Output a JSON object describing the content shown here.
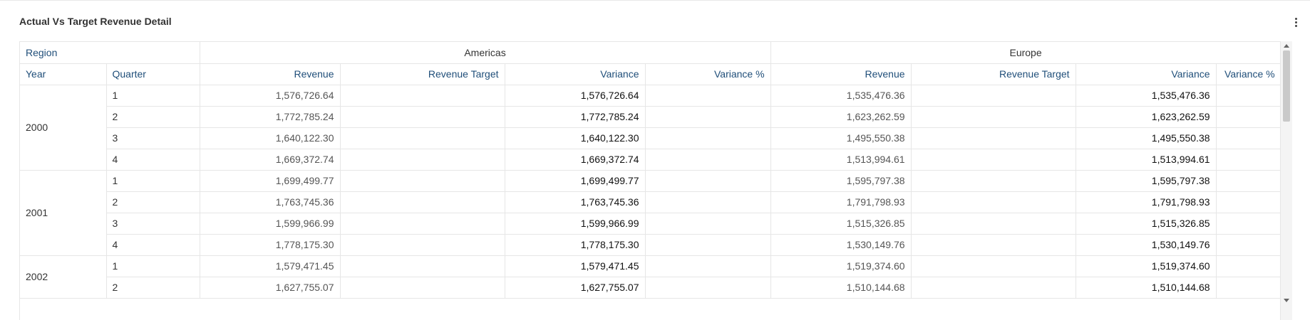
{
  "panel": {
    "title": "Actual Vs Target Revenue Detail",
    "menu_icon": "more-vertical-icon"
  },
  "table": {
    "region_label": "Region",
    "groups": [
      "Americas",
      "Europe"
    ],
    "year_label": "Year",
    "quarter_label": "Quarter",
    "columns": [
      "Revenue",
      "Revenue Target",
      "Variance",
      "Variance %"
    ],
    "years": [
      {
        "year": "2000",
        "rows": [
          {
            "quarter": "1",
            "am_rev": "1,576,726.64",
            "am_target": "",
            "am_var": "1,576,726.64",
            "am_varpct": "",
            "eu_rev": "1,535,476.36",
            "eu_target": "",
            "eu_var": "1,535,476.36",
            "eu_varpct": ""
          },
          {
            "quarter": "2",
            "am_rev": "1,772,785.24",
            "am_target": "",
            "am_var": "1,772,785.24",
            "am_varpct": "",
            "eu_rev": "1,623,262.59",
            "eu_target": "",
            "eu_var": "1,623,262.59",
            "eu_varpct": ""
          },
          {
            "quarter": "3",
            "am_rev": "1,640,122.30",
            "am_target": "",
            "am_var": "1,640,122.30",
            "am_varpct": "",
            "eu_rev": "1,495,550.38",
            "eu_target": "",
            "eu_var": "1,495,550.38",
            "eu_varpct": ""
          },
          {
            "quarter": "4",
            "am_rev": "1,669,372.74",
            "am_target": "",
            "am_var": "1,669,372.74",
            "am_varpct": "",
            "eu_rev": "1,513,994.61",
            "eu_target": "",
            "eu_var": "1,513,994.61",
            "eu_varpct": ""
          }
        ]
      },
      {
        "year": "2001",
        "rows": [
          {
            "quarter": "1",
            "am_rev": "1,699,499.77",
            "am_target": "",
            "am_var": "1,699,499.77",
            "am_varpct": "",
            "eu_rev": "1,595,797.38",
            "eu_target": "",
            "eu_var": "1,595,797.38",
            "eu_varpct": ""
          },
          {
            "quarter": "2",
            "am_rev": "1,763,745.36",
            "am_target": "",
            "am_var": "1,763,745.36",
            "am_varpct": "",
            "eu_rev": "1,791,798.93",
            "eu_target": "",
            "eu_var": "1,791,798.93",
            "eu_varpct": ""
          },
          {
            "quarter": "3",
            "am_rev": "1,599,966.99",
            "am_target": "",
            "am_var": "1,599,966.99",
            "am_varpct": "",
            "eu_rev": "1,515,326.85",
            "eu_target": "",
            "eu_var": "1,515,326.85",
            "eu_varpct": ""
          },
          {
            "quarter": "4",
            "am_rev": "1,778,175.30",
            "am_target": "",
            "am_var": "1,778,175.30",
            "am_varpct": "",
            "eu_rev": "1,530,149.76",
            "eu_target": "",
            "eu_var": "1,530,149.76",
            "eu_varpct": ""
          }
        ]
      },
      {
        "year": "2002",
        "rows": [
          {
            "quarter": "1",
            "am_rev": "1,579,471.45",
            "am_target": "",
            "am_var": "1,579,471.45",
            "am_varpct": "",
            "eu_rev": "1,519,374.60",
            "eu_target": "",
            "eu_var": "1,519,374.60",
            "eu_varpct": ""
          },
          {
            "quarter": "2",
            "am_rev": "1,627,755.07",
            "am_target": "",
            "am_var": "1,627,755.07",
            "am_varpct": "",
            "eu_rev": "1,510,144.68",
            "eu_target": "",
            "eu_var": "1,510,144.68",
            "eu_varpct": ""
          }
        ]
      }
    ]
  },
  "colors": {
    "header_text": "#1f4e79",
    "border": "#e6e6e6"
  }
}
